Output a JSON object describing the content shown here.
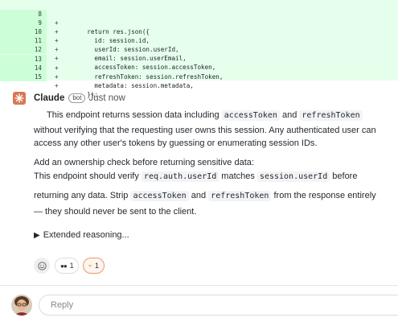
{
  "diff": {
    "lines": [
      {
        "num": "8",
        "sign": "+",
        "code": "    return res.json({"
      },
      {
        "num": "9",
        "sign": "+",
        "code": "      id: session.id,"
      },
      {
        "num": "10",
        "sign": "+",
        "code": "      userId: session.userId,"
      },
      {
        "num": "11",
        "sign": "+",
        "code": "      email: session.userEmail,"
      },
      {
        "num": "12",
        "sign": "+",
        "code": "      accessToken: session.accessToken,"
      },
      {
        "num": "13",
        "sign": "+",
        "code": "      refreshToken: session.refreshToken,"
      },
      {
        "num": "14",
        "sign": "+",
        "code": "      metadata: session.metadata,"
      },
      {
        "num": "15",
        "sign": "+",
        "code": "    });"
      }
    ]
  },
  "comment": {
    "author": "Claude",
    "badge": "bot",
    "time": "Just now",
    "p1_a": "This endpoint returns session data including ",
    "p1_code1": "accessToken",
    "p1_b": " and ",
    "p1_code2": "refreshToken",
    "p1_line2": "without verifying that the requesting user owns this session. Any authenticated user can",
    "p1_line3": "access any other user's tokens by guessing or enumerating session IDs.",
    "p2_line1": "Add an ownership check before returning sensitive data:",
    "p2_a": "This endpoint should verify ",
    "p2_code1": "req.auth.userId",
    "p2_b": " matches ",
    "p2_code2": "session.userId",
    "p2_c": " before",
    "p2_d": "returning any data. Strip ",
    "p2_code3": "accessToken",
    "p2_e": " and ",
    "p2_code4": "refreshToken",
    "p2_f": " from the response entirely",
    "p2_line4": "— they should never be sent to the client.",
    "reasoning": "Extended reasoning..."
  },
  "reactions": {
    "eyes_count": "1",
    "thumbsdown_count": "1"
  },
  "reply": {
    "placeholder": "Reply"
  },
  "colors": {
    "diff_bg": "#e6ffec",
    "brand": "#d97757",
    "reaction_active": "#e79a6f"
  },
  "icons": [
    "claude-logo-icon",
    "smiley-icon",
    "eyes-icon",
    "thumbs-down-icon",
    "disclosure-triangle-icon",
    "user-avatar"
  ]
}
